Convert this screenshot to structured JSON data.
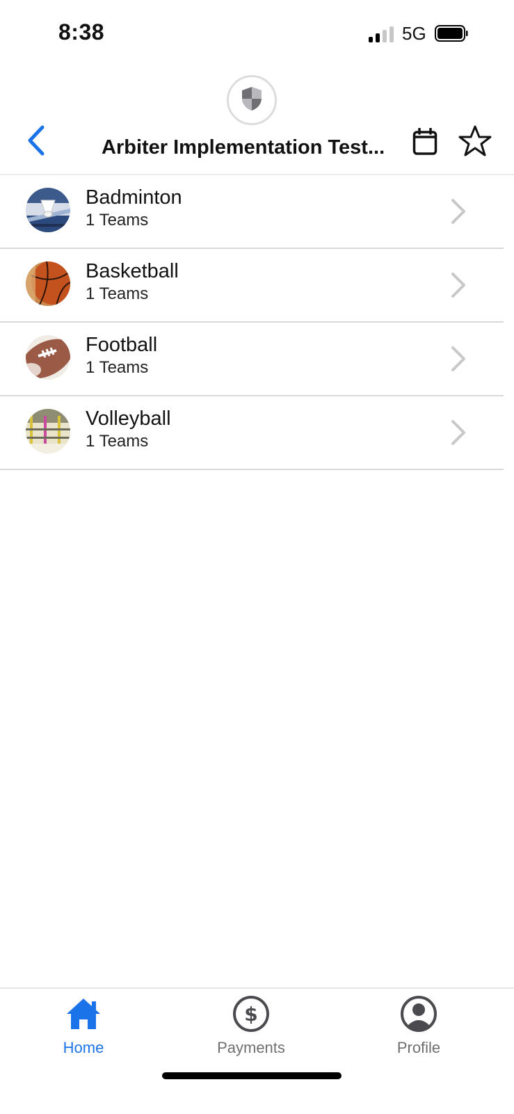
{
  "status_bar": {
    "time": "8:38",
    "network": "5G",
    "signal_icon": "cellular-signal-icon",
    "battery_icon": "battery-icon"
  },
  "header": {
    "logo_icon": "shield-icon",
    "back_icon": "chevron-left-icon",
    "title": "Arbiter Implementation Test...",
    "calendar_icon": "calendar-icon",
    "favorite_icon": "star-icon"
  },
  "sports": [
    {
      "name": "Badminton",
      "subtitle": "1 Teams",
      "thumbnail": "badminton-thumbnail"
    },
    {
      "name": "Basketball",
      "subtitle": "1 Teams",
      "thumbnail": "basketball-thumbnail"
    },
    {
      "name": "Football",
      "subtitle": "1 Teams",
      "thumbnail": "football-thumbnail"
    },
    {
      "name": "Volleyball",
      "subtitle": "1 Teams",
      "thumbnail": "volleyball-thumbnail"
    }
  ],
  "tab_bar": {
    "tabs": [
      {
        "label": "Home",
        "icon": "home-icon",
        "active": true
      },
      {
        "label": "Payments",
        "icon": "dollar-icon",
        "active": false
      },
      {
        "label": "Profile",
        "icon": "user-icon",
        "active": false
      }
    ]
  },
  "colors": {
    "accent": "#1a73e8",
    "inactive_tab": "#6e6e73",
    "divider": "#d9d9d9",
    "chevron": "#c8c8c8"
  }
}
